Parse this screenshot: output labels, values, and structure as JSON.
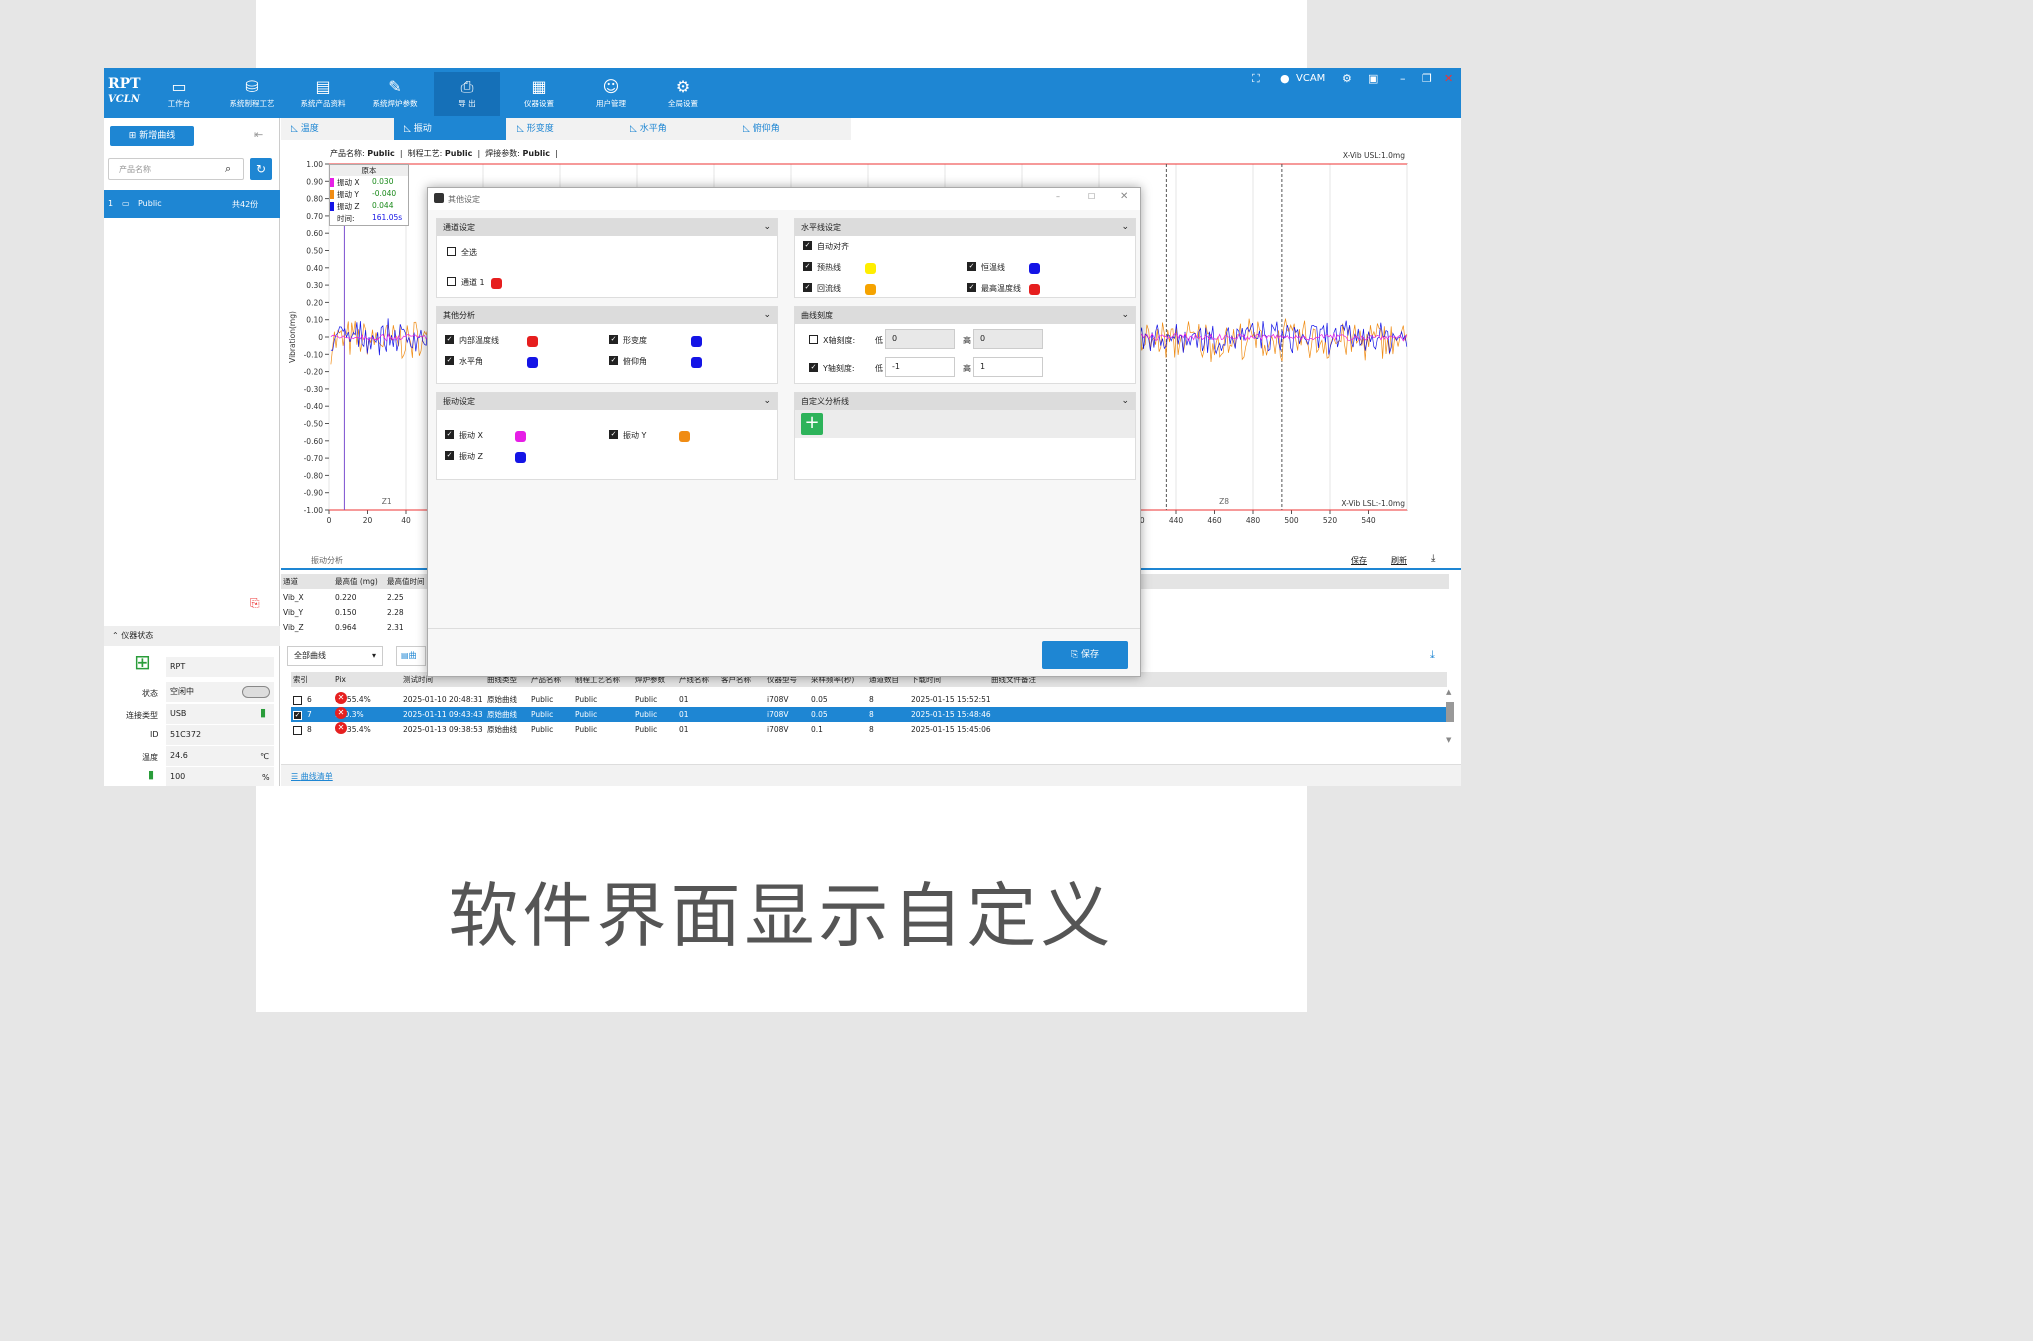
{
  "caption": "软件界面显示自定义",
  "app": {
    "logo_top": "RPT",
    "logo_bottom": "VCLN",
    "user": "VCAM"
  },
  "nav": [
    {
      "icon": "monitor-icon",
      "label": "工作台"
    },
    {
      "icon": "process-icon",
      "label": "系统制程工艺"
    },
    {
      "icon": "product-doc-icon",
      "label": "系统产品资料"
    },
    {
      "icon": "pen-icon",
      "label": "系统焊炉参数"
    },
    {
      "icon": "printer-icon",
      "label": "导 出"
    },
    {
      "icon": "device-settings-icon",
      "label": "仪器设置"
    },
    {
      "icon": "user-manage-icon",
      "label": "用户管理"
    },
    {
      "icon": "gear-icon",
      "label": "全局设置"
    }
  ],
  "sidebar": {
    "new_curve": "新增曲线",
    "search_placeholder": "产品名称",
    "item_index": "1",
    "item_name": "Public",
    "item_count": "共42份"
  },
  "tabs": [
    "温度",
    "振动",
    "形变度",
    "水平角",
    "俯仰角"
  ],
  "chart_header": {
    "product_label": "产品名称:",
    "product": "Public",
    "process_label": "制程工艺:",
    "process": "Public",
    "weld_label": "焊接参数:",
    "weld": "Public"
  },
  "legend_box": {
    "title": "原本",
    "rows": [
      {
        "label": "振动 X",
        "value": "0.030"
      },
      {
        "label": "振动 Y",
        "value": "-0.040"
      },
      {
        "label": "振动 Z",
        "value": "0.044"
      },
      {
        "label": "时间:",
        "value": "161.05s"
      }
    ]
  },
  "chart_data": {
    "type": "line",
    "ylabel": "Vibration(mg)",
    "ylim": [
      -1.0,
      1.0
    ],
    "xlim": [
      0,
      560
    ],
    "yticks": [
      "1.00",
      "0.90",
      "0.80",
      "0.70",
      "0.60",
      "0.50",
      "0.40",
      "0.30",
      "0.20",
      "0.10",
      "0",
      "-0.10",
      "-0.20",
      "-0.30",
      "-0.40",
      "-0.50",
      "-0.60",
      "-0.70",
      "-0.80",
      "-0.90",
      "-1.00"
    ],
    "xticks_left": [
      "0",
      "20",
      "40"
    ],
    "xticks_right": [
      "420",
      "440",
      "460",
      "480",
      "500",
      "520",
      "540"
    ],
    "usl_label": "X-Vib USL:1.0mg",
    "lsl_label": "X-Vib LSL:-1.0mg",
    "usl": 1.0,
    "lsl": -1.0,
    "zones": [
      "Z1",
      "Z8"
    ],
    "series": [
      {
        "name": "振动 X",
        "color": "#e61ee6"
      },
      {
        "name": "振动 Y",
        "color": "#f08c14"
      },
      {
        "name": "振动 Z",
        "color": "#1414e6"
      }
    ]
  },
  "dialog": {
    "title": "其他设定",
    "save": "保存",
    "channel": {
      "title": "通道设定",
      "select_all": "全选",
      "channel1": "通道 1"
    },
    "hline": {
      "title": "水平线设定",
      "auto": "自动对齐",
      "items": [
        {
          "label": "预热线",
          "color": "#ffee00"
        },
        {
          "label": "恒温线",
          "color": "#1414e6"
        },
        {
          "label": "回流线",
          "color": "#f5a300"
        },
        {
          "label": "最高温度线",
          "color": "#e61e1e"
        }
      ]
    },
    "other": {
      "title": "其他分析",
      "items": [
        {
          "label": "内部温度线",
          "color": "#e61e1e"
        },
        {
          "label": "形变度",
          "color": "#1414e6"
        },
        {
          "label": "水平角",
          "color": "#1414e6"
        },
        {
          "label": "俯仰角",
          "color": "#1414e6"
        }
      ]
    },
    "scale": {
      "title": "曲线刻度",
      "x_label": "X轴刻度:",
      "y_label": "Y轴刻度:",
      "low": "低",
      "high": "高",
      "x_low": "0",
      "x_high": "0",
      "y_low": "-1",
      "y_high": "1"
    },
    "vib": {
      "title": "振动设定",
      "items": [
        {
          "label": "振动 X",
          "color": "#e61ee6"
        },
        {
          "label": "振动 Y",
          "color": "#f08c14"
        },
        {
          "label": "振动 Z",
          "color": "#1414e6"
        }
      ]
    },
    "custom": {
      "title": "自定义分析线"
    }
  },
  "analysis": {
    "title": "振动分析",
    "save": "保存",
    "refresh": "刷新",
    "headers": [
      "通道",
      "最高值 (mg)",
      "最高值时间"
    ],
    "rows": [
      [
        "Vib_X",
        "0.220",
        "2.25"
      ],
      [
        "Vib_Y",
        "0.150",
        "2.28"
      ],
      [
        "Vib_Z",
        "0.964",
        "2.31"
      ]
    ]
  },
  "device": {
    "title": "仪器状态",
    "name": "RPT",
    "status_label": "状态",
    "status": "空闲中",
    "conn_label": "连接类型",
    "conn": "USB",
    "id_label": "ID",
    "id": "51C372",
    "temp_label": "温度",
    "temp": "24.6",
    "temp_unit": "℃",
    "battery": "100",
    "battery_unit": "%"
  },
  "curvelist": {
    "filter": "全部曲线",
    "curve_btn": "曲",
    "footer": "曲线清单",
    "headers": [
      "索引",
      "Pix",
      "测试时间",
      "曲线类型",
      "产品名称",
      "制程工艺名称",
      "焊炉参数",
      "产线名称",
      "客户名称",
      "仪器型号",
      "采样频率(秒)",
      "通道数目",
      "下载时间",
      "曲线文件备注"
    ],
    "rows": [
      {
        "idx": "6",
        "pix": "1,055.4%",
        "time": "2025-01-10 20:48:31",
        "type": "原始曲线",
        "product": "Public",
        "process": "Public",
        "weld": "Public",
        "line": "01",
        "model": "i708V",
        "freq": "0.05",
        "ch": "8",
        "dl": "2025-01-15 15:52:51"
      },
      {
        "idx": "7",
        "pix": "990.3%",
        "time": "2025-01-11 09:43:43",
        "type": "原始曲线",
        "product": "Public",
        "process": "Public",
        "weld": "Public",
        "line": "01",
        "model": "i708V",
        "freq": "0.05",
        "ch": "8",
        "dl": "2025-01-15 15:48:46"
      },
      {
        "idx": "8",
        "pix": "4,535.4%",
        "time": "2025-01-13 09:38:53",
        "type": "原始曲线",
        "product": "Public",
        "process": "Public",
        "weld": "Public",
        "line": "01",
        "model": "i708V",
        "freq": "0.1",
        "ch": "8",
        "dl": "2025-01-15 15:45:06"
      }
    ]
  }
}
